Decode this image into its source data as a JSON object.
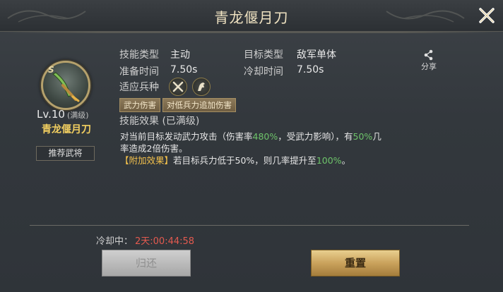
{
  "header": {
    "title": "青龙偃月刀"
  },
  "left": {
    "level": "Lv.10",
    "level_state": "(满级)",
    "skill_name": "青龙偃月刀",
    "recommend_label": "推荐武将",
    "badge": "S"
  },
  "info": {
    "type_label": "技能类型",
    "type_value": "主动",
    "target_label": "目标类型",
    "target_value": "敌军单体",
    "prep_label": "准备时间",
    "prep_value": "7.50s",
    "cooldown_label": "冷却时间",
    "cooldown_value": "7.50s",
    "troop_label": "适应兵种",
    "troop_icons": [
      "infantry-icon",
      "cavalry-icon"
    ]
  },
  "tags": [
    "武力伤害",
    "对低兵力追加伤害"
  ],
  "effect": {
    "title": "技能效果 (已满级)",
    "line1_a": "对当前目标发动武力攻击（伤害率",
    "line1_pct": "480%",
    "line1_b": "，受武力影响），有",
    "line1_chance": "50%",
    "line1_c": "几率造成2倍伤害。",
    "bonus_tag": "【附加效果】",
    "line2_a": "若目标兵力低于50%，则几率提升至",
    "line2_pct": "100%",
    "line2_b": "。"
  },
  "share": {
    "label": "分享"
  },
  "cooldown": {
    "label": "冷却中：",
    "value": "2天:00:44:58"
  },
  "buttons": {
    "return": "归还",
    "reset": "重置"
  },
  "colors": {
    "accent_gold": "#f2c04c",
    "highlight_green": "#6ec46a",
    "cooldown_red": "#e35a4f"
  }
}
